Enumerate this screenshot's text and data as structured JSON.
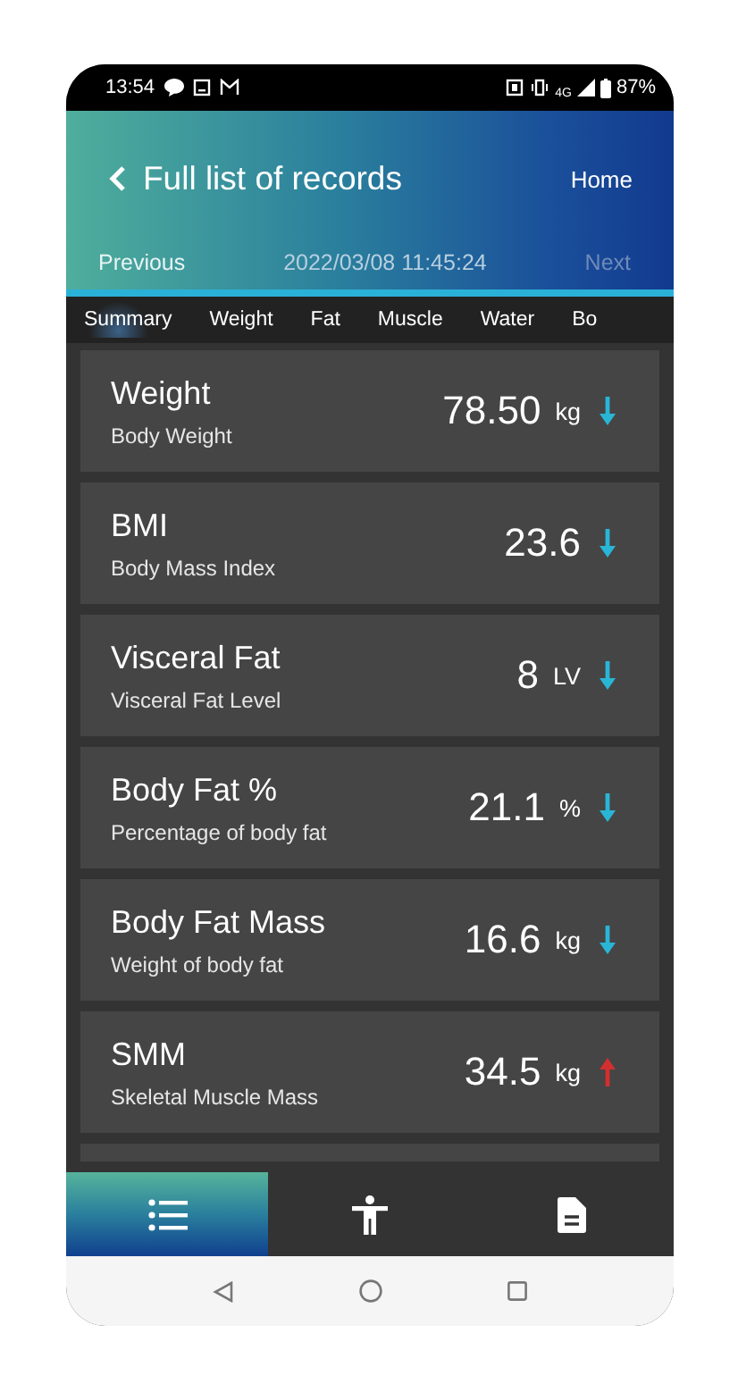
{
  "status_bar": {
    "time": "13:54",
    "network": "4G",
    "battery": "87%"
  },
  "header": {
    "title": "Full list of records",
    "home": "Home",
    "previous": "Previous",
    "datetime": "2022/03/08 11:45:24",
    "next": {
      "label": "Next",
      "disabled": true
    }
  },
  "tabs": [
    {
      "label": "Summary",
      "selected": true
    },
    {
      "label": "Weight",
      "selected": false
    },
    {
      "label": "Fat",
      "selected": false
    },
    {
      "label": "Muscle",
      "selected": false
    },
    {
      "label": "Water",
      "selected": false
    },
    {
      "label": "Bo",
      "selected": false
    }
  ],
  "records": [
    {
      "name": "Weight",
      "description": "Body Weight",
      "value": "78.50",
      "unit": "kg",
      "kind": "down"
    },
    {
      "name": "BMI",
      "description": "Body Mass Index",
      "value": "23.6",
      "kind": "down"
    },
    {
      "name": "Visceral Fat",
      "description": "Visceral Fat Level",
      "value": "8",
      "unit": "LV",
      "kind": "down"
    },
    {
      "name": "Body Fat %",
      "description": "Percentage of body fat",
      "value": "21.1",
      "unit": "%",
      "kind": "down"
    },
    {
      "name": "Body Fat Mass",
      "description": "Weight of body fat",
      "value": "16.6",
      "unit": "kg",
      "kind": "down"
    },
    {
      "name": "SMM",
      "description": "Skeletal Muscle Mass",
      "value": "34.5",
      "unit": "kg",
      "kind": "up"
    }
  ],
  "bottom_nav": [
    {
      "kind": "list",
      "selected": true
    },
    {
      "kind": "body",
      "selected": false
    },
    {
      "kind": "report",
      "selected": false
    }
  ]
}
